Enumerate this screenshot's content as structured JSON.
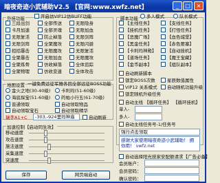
{
  "window": {
    "title": "暗夜奇迹小武辅助V2.5 【官网:www.xwfz.net】",
    "minimize": "_",
    "maximize": "□",
    "close": "×"
  },
  "plugin": {
    "title": "外挂功能",
    "options": [
      "三段出剑",
      "卡月加速",
      "无限复活",
      "无限剑阵",
      "招招暴击",
      "全聚暴击",
      "全聚炼骨",
      "全聚物理",
      "全聚魔攻",
      "无限魔攻",
      "全体追踪",
      "全体攻击",
      "无限闪避",
      "无限加血",
      "防止强化",
      "净化RPG",
      "全聚变速",
      "无限连击"
    ],
    "vip_label": "开启仿VIP12仿BUFF功能",
    "vip_options": [
      "全部传送",
      "全部灵魂",
      "防止掉落",
      "无限加血",
      "仿收掉落",
      "仿收变速"
    ],
    "right_options": [
      "无限隐身",
      "无限加血",
      "无限剑阵",
      "无限闪避",
      "无限复活",
      "无限魔攻"
    ]
  },
  "map": {
    "title": "地图设置",
    "subtitle": "一键免费远征军雅各回全部远征BOSS功能",
    "options": [
      "金火之地(30-40级)",
      "海底探宝(51-60级)",
      "普通领取"
    ],
    "options2": [
      "卡利玛(51-60级)",
      "的帕小行五(61-70级)",
      "自动领取"
    ],
    "item1": "自动领取物品",
    "item2": "自动领取宝石",
    "item3": "自动领取精华",
    "input_label": "瑞字A1+C",
    "input_value": "-303,-924里玛神庙",
    "auto_button": "自动刷新",
    "coord_label": "自动领取"
  },
  "speed": {
    "title": "加速控制【启动同生攻】",
    "rows": [
      "移动速度",
      "攻击速度",
      "施法速度",
      "采集速度",
      "突速度"
    ],
    "levels": [
      0.2,
      0.2,
      0.25,
      0.2,
      0.25
    ]
  },
  "script": {
    "title": "脚本功能",
    "mode1": "多人模式",
    "mode2": "队长模式",
    "items": [
      "【主线任务】",
      "【支线任务】",
      "【挂机任务】",
      "【打怪任务】",
      "【恶魔广场】",
      "【血色城堡】",
      "【黑金任务】",
      "【赤色要塞】",
      "【卡利玛神殿】",
      "【自动挂机】",
      "【道场任务】",
      "【魔王宝藏】",
      "【金币副本】",
      "【组队副本】"
    ],
    "activate": "自动刷新脚本",
    "lock_boss": "锁定BOSS次数",
    "star_rank": "星辰数值属性",
    "vip_level": "VIP12 关系模式",
    "auto_upgrade": "自动随机功能升级",
    "auto_main": "锁定随机升级任务",
    "single_person": "自动主线 【循环任务】",
    "single_person2": "【循环挂机】",
    "multi_person": "单人-",
    "multi_person2": "多人-",
    "switch_label": "自动主线任务号-1/任务号",
    "dropdown": "强行点击领取",
    "notice": "感谢大家使用暗夜奇迹小武辅助！ 拥你用！ vwfz.net"
  },
  "expiry_note": "自动选择阳光技家安配额请求【广告必备】",
  "account": {
    "member_id_label": "会员账户：",
    "member_pwd_label": "会员密码：",
    "confirm_label": "确认密码："
  },
  "buttons": {
    "save": "保存",
    "web": "网页端启动"
  }
}
